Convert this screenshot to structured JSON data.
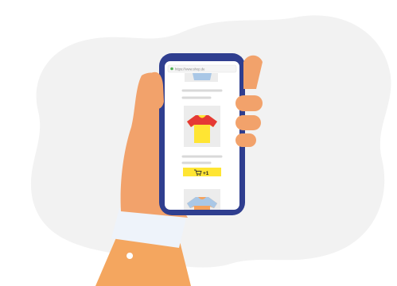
{
  "browser": {
    "url": "https://www.shop.de",
    "secure_indicator_color": "#4caf50"
  },
  "product_list": {
    "items": [
      {
        "name": "blue-tshirt",
        "shirt_color": "#a9c7e6",
        "trim_color": "#8fb4da",
        "partially_visible": true
      },
      {
        "name": "yellow-tshirt",
        "shirt_color": "#ffe533",
        "trim_color": "#e53935",
        "partially_visible": false
      },
      {
        "name": "orange-tshirt",
        "shirt_color": "#f5a25d",
        "trim_color": "#a9c7e6",
        "partially_visible": true
      }
    ],
    "add_to_cart": {
      "label": "+1",
      "icon": "cart-icon",
      "button_color": "#ffe533"
    }
  },
  "colors": {
    "phone_frame": "#2f3e8f",
    "screen": "#ffffff",
    "skin": "#f2a26b",
    "sleeve": "#f4a65f",
    "cuff": "#eef3fa",
    "background_blob": "#f2f2f2",
    "placeholder_line": "#d9d9d9"
  }
}
